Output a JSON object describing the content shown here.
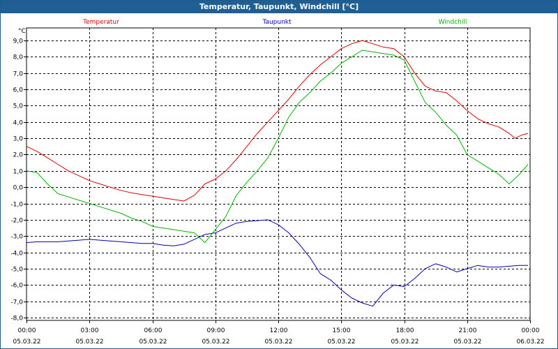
{
  "window": {
    "title": "Temperatur, Taupunkt, Windchill [°C]"
  },
  "chart_data": {
    "type": "line",
    "title": "Temperatur, Taupunkt, Windchill [°C]",
    "ylabel": "°C",
    "ylim": [
      -8.0,
      9.0
    ],
    "yticks": [
      "9,0",
      "8,0",
      "7,0",
      "6,0",
      "5,0",
      "4,0",
      "3,0",
      "2,0",
      "1,0",
      "0,0",
      "-1,0",
      "-2,0",
      "-3,0",
      "-4,0",
      "-5,0",
      "-6,0",
      "-7,0",
      "-8,0"
    ],
    "xlim": [
      0,
      24
    ],
    "xticks": [
      {
        "h": 0,
        "time": "00:00",
        "date": "05.03.22"
      },
      {
        "h": 3,
        "time": "03:00",
        "date": "05.03.22"
      },
      {
        "h": 6,
        "time": "06:00",
        "date": "05.03.22"
      },
      {
        "h": 9,
        "time": "09:00",
        "date": "05.03.22"
      },
      {
        "h": 12,
        "time": "12:00",
        "date": "05.03.22"
      },
      {
        "h": 15,
        "time": "15:00",
        "date": "05.03.22"
      },
      {
        "h": 18,
        "time": "18:00",
        "date": "05.03.22"
      },
      {
        "h": 21,
        "time": "21:00",
        "date": "05.03.22"
      },
      {
        "h": 24,
        "time": "00:00",
        "date": "06.03.22"
      }
    ],
    "grid": true,
    "legend_placement": "top",
    "series": [
      {
        "name": "Temperatur",
        "color": "#dd0000",
        "x": [
          0,
          0.5,
          1,
          1.5,
          2,
          2.5,
          3,
          3.5,
          4,
          4.5,
          5,
          5.5,
          6,
          6.5,
          7,
          7.5,
          8,
          8.5,
          9,
          9.5,
          10,
          10.5,
          11,
          11.5,
          12,
          12.5,
          13,
          13.5,
          14,
          14.5,
          15,
          15.5,
          16,
          16.5,
          17,
          17.5,
          18,
          18.5,
          19,
          19.5,
          20,
          20.5,
          21,
          21.5,
          22,
          22.5,
          23,
          23.3,
          23.6,
          23.9
        ],
        "y": [
          2.5,
          2.2,
          1.8,
          1.4,
          1.0,
          0.7,
          0.4,
          0.2,
          0.0,
          -0.2,
          -0.35,
          -0.45,
          -0.55,
          -0.65,
          -0.75,
          -0.85,
          -0.5,
          0.2,
          0.5,
          1.0,
          1.7,
          2.5,
          3.3,
          4.0,
          4.7,
          5.4,
          6.2,
          6.9,
          7.5,
          8.0,
          8.5,
          8.8,
          9.0,
          8.8,
          8.6,
          8.5,
          8.0,
          7.0,
          6.2,
          5.9,
          5.8,
          5.3,
          4.7,
          4.2,
          3.9,
          3.7,
          3.3,
          3.0,
          3.2,
          3.3
        ]
      },
      {
        "name": "Taupunkt",
        "color": "#0000b4",
        "x": [
          0,
          0.5,
          1,
          1.5,
          2,
          2.5,
          3,
          3.5,
          4,
          4.5,
          5,
          5.5,
          6,
          6.5,
          7,
          7.5,
          8,
          8.5,
          9,
          9.5,
          10,
          10.5,
          11,
          11.5,
          12,
          12.5,
          13,
          13.5,
          14,
          14.5,
          15,
          15.5,
          16,
          16.5,
          17,
          17.5,
          18,
          18.5,
          19,
          19.5,
          20,
          20.5,
          21,
          21.5,
          22,
          22.5,
          23,
          23.5,
          23.9
        ],
        "y": [
          -3.4,
          -3.35,
          -3.35,
          -3.35,
          -3.3,
          -3.25,
          -3.2,
          -3.25,
          -3.3,
          -3.35,
          -3.4,
          -3.45,
          -3.45,
          -3.55,
          -3.6,
          -3.5,
          -3.2,
          -2.9,
          -2.8,
          -2.5,
          -2.2,
          -2.1,
          -2.05,
          -2.0,
          -2.3,
          -2.8,
          -3.5,
          -4.3,
          -5.3,
          -5.7,
          -6.3,
          -6.8,
          -7.1,
          -7.3,
          -6.5,
          -6.0,
          -6.1,
          -5.6,
          -5.0,
          -4.7,
          -4.9,
          -5.2,
          -5.0,
          -4.8,
          -4.9,
          -4.9,
          -4.85,
          -4.8,
          -4.8
        ]
      },
      {
        "name": "Windchill",
        "color": "#00b400",
        "x": [
          0,
          0.5,
          1,
          1.5,
          2,
          2.5,
          3,
          3.5,
          4,
          4.5,
          5,
          5.5,
          6,
          6.5,
          7,
          7.5,
          8,
          8.5,
          9,
          9.5,
          10,
          10.5,
          11,
          11.5,
          12,
          12.5,
          13,
          13.5,
          14,
          14.5,
          15,
          15.5,
          16,
          16.5,
          17,
          17.5,
          18,
          18.5,
          19,
          19.5,
          20,
          20.5,
          21,
          21.5,
          22,
          22.5,
          23,
          23.5,
          23.9
        ],
        "y": [
          1.0,
          0.9,
          0.2,
          -0.4,
          -0.6,
          -0.8,
          -1.0,
          -1.2,
          -1.4,
          -1.6,
          -1.9,
          -2.1,
          -2.4,
          -2.5,
          -2.6,
          -2.7,
          -2.8,
          -3.4,
          -2.6,
          -1.8,
          -0.5,
          0.3,
          1.0,
          1.8,
          3.0,
          4.3,
          5.2,
          5.8,
          6.5,
          7.0,
          7.6,
          8.0,
          8.4,
          8.3,
          8.2,
          8.1,
          7.8,
          6.5,
          5.2,
          4.6,
          3.8,
          3.2,
          2.0,
          1.6,
          1.2,
          0.8,
          0.2,
          0.8,
          1.4
        ]
      }
    ]
  }
}
